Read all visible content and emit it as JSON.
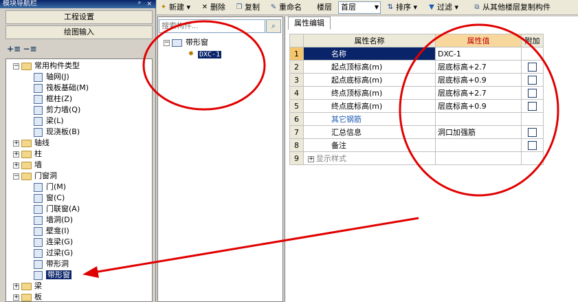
{
  "nav": {
    "title": "模块导航栏",
    "pin": "ᵖ",
    "close": "×",
    "project_settings": "工程设置",
    "drawing_input": "绘图输入",
    "tree": [
      {
        "label": "常用构件类型",
        "level": 0,
        "type": "folder",
        "expanded": true
      },
      {
        "label": "轴网(J)",
        "level": 1,
        "type": "item"
      },
      {
        "label": "筏板基础(M)",
        "level": 1,
        "type": "item"
      },
      {
        "label": "框柱(Z)",
        "level": 1,
        "type": "item"
      },
      {
        "label": "剪力墙(Q)",
        "level": 1,
        "type": "item"
      },
      {
        "label": "梁(L)",
        "level": 1,
        "type": "item"
      },
      {
        "label": "现浇板(B)",
        "level": 1,
        "type": "item"
      },
      {
        "label": "轴线",
        "level": 0,
        "type": "folder",
        "expanded": false
      },
      {
        "label": "柱",
        "level": 0,
        "type": "folder",
        "expanded": false
      },
      {
        "label": "墙",
        "level": 0,
        "type": "folder",
        "expanded": false
      },
      {
        "label": "门窗洞",
        "level": 0,
        "type": "folder",
        "expanded": true
      },
      {
        "label": "门(M)",
        "level": 1,
        "type": "item"
      },
      {
        "label": "窗(C)",
        "level": 1,
        "type": "item"
      },
      {
        "label": "门联窗(A)",
        "level": 1,
        "type": "item"
      },
      {
        "label": "墙洞(D)",
        "level": 1,
        "type": "item"
      },
      {
        "label": "壁龛(I)",
        "level": 1,
        "type": "item"
      },
      {
        "label": "连梁(G)",
        "level": 1,
        "type": "item"
      },
      {
        "label": "过梁(G)",
        "level": 1,
        "type": "item"
      },
      {
        "label": "带形洞",
        "level": 1,
        "type": "item"
      },
      {
        "label": "带形窗",
        "level": 1,
        "type": "item",
        "selected": true
      },
      {
        "label": "梁",
        "level": 0,
        "type": "folder",
        "expanded": false
      },
      {
        "label": "板",
        "level": 0,
        "type": "folder",
        "expanded": false
      }
    ]
  },
  "toolbar": {
    "new": "新建",
    "delete": "删除",
    "copy": "复制",
    "rename": "重命名",
    "floor_label": "楼层",
    "floor_value": "首层",
    "sort": "排序",
    "filter": "过滤",
    "copy_from_floor": "从其他楼层复制构件"
  },
  "component_list": {
    "search_placeholder": "搜索构件...",
    "group": "带形窗",
    "item": "DXC-1"
  },
  "properties": {
    "tab": "属性编辑",
    "col_name": "属性名称",
    "col_value": "属性值",
    "col_extra": "附加",
    "rows": [
      {
        "num": "1",
        "name": "名称",
        "value": "DXC-1",
        "check": false,
        "style": "hl"
      },
      {
        "num": "2",
        "name": "起点顶标高(m)",
        "value": "层底标高+2.7",
        "check": true,
        "style": ""
      },
      {
        "num": "3",
        "name": "起点底标高(m)",
        "value": "层底标高+0.9",
        "check": true,
        "style": ""
      },
      {
        "num": "4",
        "name": "终点顶标高(m)",
        "value": "层底标高+2.7",
        "check": true,
        "style": ""
      },
      {
        "num": "5",
        "name": "终点底标高(m)",
        "value": "层底标高+0.9",
        "check": true,
        "style": ""
      },
      {
        "num": "6",
        "name": "其它钢筋",
        "value": "",
        "check": false,
        "style": "blue"
      },
      {
        "num": "7",
        "name": "汇总信息",
        "value": "洞口加强筋",
        "check": true,
        "style": ""
      },
      {
        "num": "8",
        "name": "备注",
        "value": "",
        "check": true,
        "style": ""
      },
      {
        "num": "9",
        "name": "显示样式",
        "value": "",
        "check": false,
        "style": "gray"
      }
    ]
  },
  "colors": {
    "annotation": "#e00000",
    "selection": "#0a246a",
    "value_header": "#f8d79c"
  }
}
